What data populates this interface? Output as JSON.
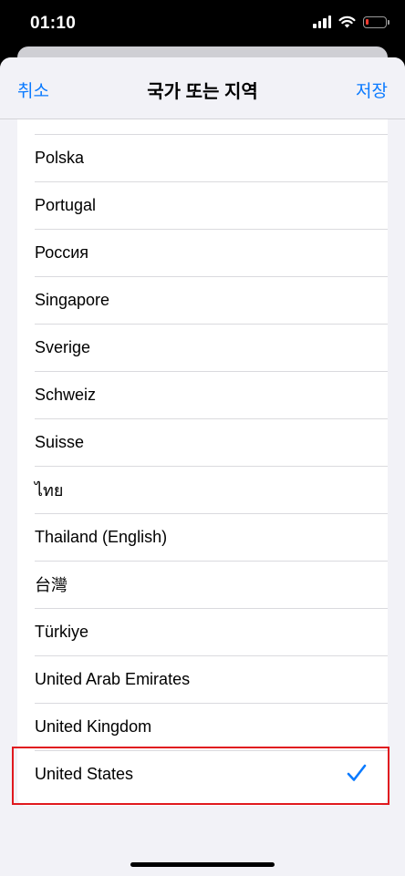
{
  "status_bar": {
    "time": "01:10",
    "signal_icon": "cellular-signal-icon",
    "wifi_icon": "wifi-icon",
    "battery_icon": "battery-low-icon",
    "battery_level": 0.15,
    "battery_color": "#ff3b30"
  },
  "nav": {
    "cancel_label": "취소",
    "title": "국가 또는 지역",
    "save_label": "저장",
    "accent_color": "#0a7aff"
  },
  "list": {
    "items": [
      {
        "label": "Polska",
        "selected": false
      },
      {
        "label": "Portugal",
        "selected": false
      },
      {
        "label": "Россия",
        "selected": false
      },
      {
        "label": "Singapore",
        "selected": false
      },
      {
        "label": "Sverige",
        "selected": false
      },
      {
        "label": "Schweiz",
        "selected": false
      },
      {
        "label": "Suisse",
        "selected": false
      },
      {
        "label": "ไทย",
        "selected": false
      },
      {
        "label": "Thailand (English)",
        "selected": false
      },
      {
        "label": "台灣",
        "selected": false
      },
      {
        "label": "Türkiye",
        "selected": false
      },
      {
        "label": "United Arab Emirates",
        "selected": false
      },
      {
        "label": "United Kingdom",
        "selected": false
      },
      {
        "label": "United States",
        "selected": true
      }
    ],
    "selected_icon": "checkmark-icon",
    "highlight_color": "#e0191f"
  }
}
